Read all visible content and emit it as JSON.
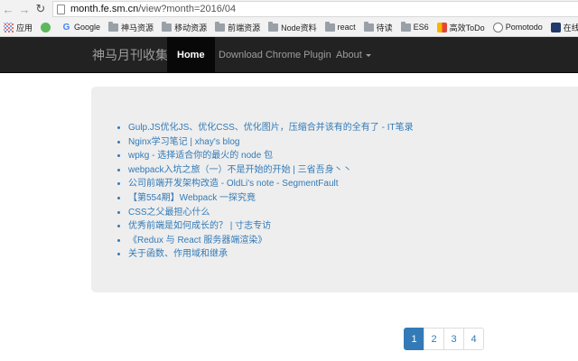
{
  "browser": {
    "url_host": "month.fe.sm.cn",
    "url_path": "/view?month=2016/04"
  },
  "bookmarks": [
    {
      "label": "应用",
      "icon": "apps-icon"
    },
    {
      "label": "",
      "icon": "cloud-icon"
    },
    {
      "label": "Google",
      "icon": "google-icon"
    },
    {
      "label": "神马资源",
      "icon": "folder-icon"
    },
    {
      "label": "移动资源",
      "icon": "folder-icon"
    },
    {
      "label": "前端资源",
      "icon": "folder-icon"
    },
    {
      "label": "Node资料",
      "icon": "folder-icon"
    },
    {
      "label": "react",
      "icon": "folder-icon"
    },
    {
      "label": "待读",
      "icon": "folder-icon"
    },
    {
      "label": "ES6",
      "icon": "folder-icon"
    },
    {
      "label": "高效ToDo",
      "icon": "todo-icon"
    },
    {
      "label": "Pomotodo",
      "icon": "pomotodo-icon"
    },
    {
      "label": "在线课",
      "icon": "course-icon"
    }
  ],
  "navbar": {
    "brand": "神马月刊收集",
    "home": "Home",
    "download": "Download Chrome Plugin",
    "about": "About"
  },
  "articles": [
    "Gulp.JS优化JS、优化CSS、优化图片，压缩合并该有的全有了 - IT笔录",
    "Nginx学习笔记 | xhay's blog",
    "wpkg - 选择适合你的最火的 node 包",
    "webpack入坑之旅（一）不是开始的开始 | 三省吾身丶丶",
    "公司前端开发架构改造 - OldLi's note - SegmentFault",
    "【第554期】Webpack 一探究竟",
    "CSS之父最担心什么",
    "优秀前端是如何成长的？ | 寸志专访",
    "《Redux 与 React 服务器端渲染》",
    "关于函数、作用域和继承"
  ],
  "pagination": {
    "pages": [
      "1",
      "2",
      "3",
      "4"
    ],
    "active": "1"
  },
  "colors": {
    "link": "#337ab7",
    "navbar_bg": "#222222",
    "panel_bg": "#eeeeee"
  }
}
